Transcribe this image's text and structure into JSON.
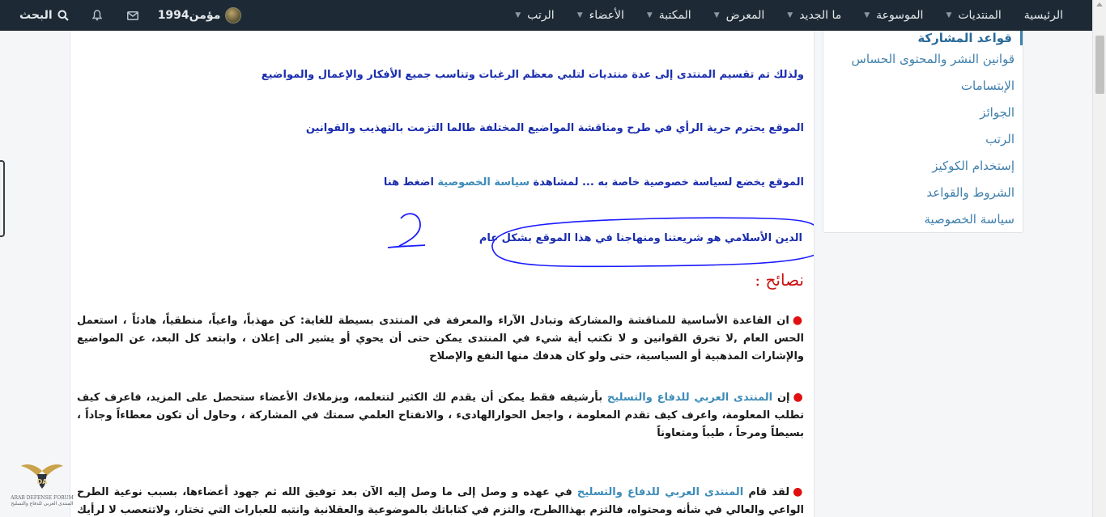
{
  "nav": {
    "items": [
      {
        "label": "الرئيسية",
        "caret": false
      },
      {
        "label": "المنتديات",
        "caret": true
      },
      {
        "label": "الموسوعة",
        "caret": true
      },
      {
        "label": "ما الجديد",
        "caret": true
      },
      {
        "label": "المعرض",
        "caret": true
      },
      {
        "label": "المكتبة",
        "caret": true
      },
      {
        "label": "الأعضاء",
        "caret": true
      },
      {
        "label": "الرتب",
        "caret": true
      }
    ],
    "username": "مؤمن1994",
    "search_label": "البحث"
  },
  "sidebar": {
    "items": [
      "قواعد المشاركة",
      "قوانين النشر والمحتوى الحساس",
      "الإبتسامات",
      "الجوائز",
      "الرتب",
      "إستخدام الكوكيز",
      "الشروط والقواعد",
      "سياسة الخصوصية"
    ]
  },
  "content": {
    "line1": "ولذلك تم تقسيم المنتدى إلى عدة منتديات لتلبي معظم الرغبات وتناسب جميع الأفكار والإعمال والمواضيع",
    "line2": "الموقع يحترم حرية الرأي في طرح ومناقشة المواضيع المختلفة طالما التزمت بالتهذيب والقوانين",
    "line3_before": "الموقع يخضع لسياسة خصوصية خاصة به ... لمشاهدة ",
    "line3_link": "سياسة الخصوصية",
    "line3_after": " اضغط هنا",
    "line4": "الدين الأسلامي هو شريعتنا ومنهاجنا في هذا الموقع بشكل عام",
    "heading": "نصائح :",
    "para1": "ان القاعدة الأساسية للمناقشة والمشاركة وتبادل الآراء والمعرفة في المنتدى بسيطة للغاية: كن مهذباً، واعياً، منطقياً، هادئاً ، استعمل الحس العام ,لا تخرق القوانين و لا تكتب أية شيء في المنتدى يمكن حتى أن يحوي أو يشير الى إعلان ، وابتعد كل البعد، عن المواضيع والإشارات المذهبية أو السياسية، حتى ولو كان هدفك منها النفع والإصلاح",
    "para2_before": "إن ",
    "para2_link": "المنتدى العربي للدفاع والتسليح",
    "para2_after": " بأرشيفه فقط يمكن أن يقدم لك الكثير لتتعلمه، وبزملاءك الأعضاء ستحصل على المزيد، فاعرف كيف تطلب المعلومة، واعرف كيف تقدم المعلومة ، واجعل الحوارالهادىء ، والانفتاح العلمي سمتك في المشاركة ، وحاول أن تكون معطاءاً وجاداً ، بسيطاً ومرحاً ، طيباً ومتعاوناً",
    "para3_before": "لقد قام ",
    "para3_link": "المنتدى العربي للدفاع والتسليح",
    "para3_after": " في عهده و وصل إلى ما وصل إليه الآن بعد توفيق الله ثم جهود أعضاءها، بسبب نوعية الطرح الواعي والعالي في شأنه ومحتواه، فالتزم بهذاالطرح، والتزم في كتاباتك بالموضوعية والعقلانية وانتبه للعبارات التي تختار، ولاتتعصب لا لرأيك ولا لرأي صاحبك"
  },
  "logo": {
    "line1": "ARAB DEFENSE FORUM",
    "line2": "المنتدى العربي للدفاع والتسليح"
  },
  "colors": {
    "topbar": "#1d2a35",
    "link": "#3d8bb8",
    "text_blue": "#1a2dae",
    "heading_red": "#cc1111",
    "annotation": "#1a1aff"
  }
}
